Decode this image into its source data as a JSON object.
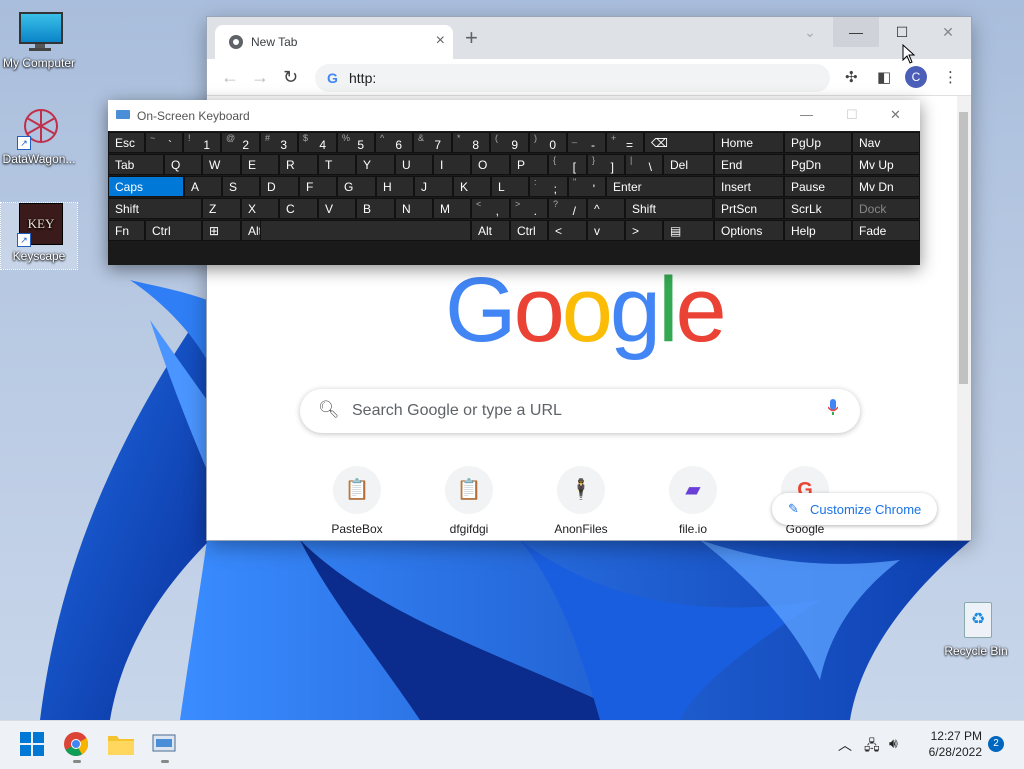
{
  "desktop": {
    "icons": [
      {
        "label": "My Computer",
        "icon": "monitor-icon"
      },
      {
        "label": "DataWagon...",
        "icon": "datawagon-icon"
      },
      {
        "label": "Keyscape",
        "icon": "keyscape-icon",
        "badge": "KEY"
      },
      {
        "label": "Recycle Bin",
        "icon": "recycle-bin-icon"
      }
    ]
  },
  "chrome": {
    "tab_title": "New Tab",
    "tab_close": "×",
    "new_tab": "+",
    "omnibox_text": "http:",
    "omnibox_g": "G",
    "avatar_letter": "C",
    "logo_letters": [
      {
        "ch": "G",
        "color": "#4285f4"
      },
      {
        "ch": "o",
        "color": "#ea4335"
      },
      {
        "ch": "o",
        "color": "#fbbc05"
      },
      {
        "ch": "g",
        "color": "#4285f4"
      },
      {
        "ch": "l",
        "color": "#34a853"
      },
      {
        "ch": "e",
        "color": "#ea4335"
      }
    ],
    "search_placeholder": "Search Google or type a URL",
    "shortcuts": [
      {
        "label": "PasteBox",
        "icon": "clipboard-icon",
        "glyph": "📋"
      },
      {
        "label": "dfgifdgi",
        "icon": "clipboard-icon",
        "glyph": "📋"
      },
      {
        "label": "AnonFiles",
        "icon": "anonfiles-icon",
        "glyph": "🕴"
      },
      {
        "label": "file.io",
        "icon": "fileio-icon",
        "glyph": "▰"
      },
      {
        "label": "Google",
        "icon": "google-icon",
        "glyph": "G"
      }
    ],
    "customize_label": "Customize Chrome"
  },
  "osk": {
    "title": "On-Screen Keyboard",
    "rows": [
      [
        {
          "m": "Esc"
        },
        {
          "s": "~",
          "b": "`"
        },
        {
          "s": "!",
          "b": "1"
        },
        {
          "s": "@",
          "b": "2"
        },
        {
          "s": "#",
          "b": "3"
        },
        {
          "s": "$",
          "b": "4"
        },
        {
          "s": "%",
          "b": "5"
        },
        {
          "s": "^",
          "b": "6"
        },
        {
          "s": "&",
          "b": "7"
        },
        {
          "s": "*",
          "b": "8"
        },
        {
          "s": "(",
          "b": "9"
        },
        {
          "s": ")",
          "b": "0"
        },
        {
          "s": "_",
          "b": "-"
        },
        {
          "s": "+",
          "b": "="
        },
        {
          "m": "⌫"
        },
        {
          "m": "Home"
        },
        {
          "m": "PgUp"
        },
        {
          "m": "Nav"
        }
      ],
      [
        {
          "m": "Tab"
        },
        {
          "m": "Q"
        },
        {
          "m": "W"
        },
        {
          "m": "E"
        },
        {
          "m": "R"
        },
        {
          "m": "T"
        },
        {
          "m": "Y"
        },
        {
          "m": "U"
        },
        {
          "m": "I"
        },
        {
          "m": "O"
        },
        {
          "m": "P"
        },
        {
          "s": "{",
          "b": "["
        },
        {
          "s": "}",
          "b": "]"
        },
        {
          "s": "|",
          "b": "\\"
        },
        {
          "m": "Del"
        },
        {
          "m": "End"
        },
        {
          "m": "PgDn"
        },
        {
          "m": "Mv Up"
        }
      ],
      [
        {
          "m": "Caps"
        },
        {
          "m": "A"
        },
        {
          "m": "S"
        },
        {
          "m": "D"
        },
        {
          "m": "F"
        },
        {
          "m": "G"
        },
        {
          "m": "H"
        },
        {
          "m": "J"
        },
        {
          "m": "K"
        },
        {
          "m": "L"
        },
        {
          "s": ":",
          "b": ";"
        },
        {
          "s": "\"",
          "b": "'"
        },
        {
          "m": "Enter"
        },
        {
          "m": "Insert"
        },
        {
          "m": "Pause"
        },
        {
          "m": "Mv Dn"
        }
      ],
      [
        {
          "m": "Shift"
        },
        {
          "m": "Z"
        },
        {
          "m": "X"
        },
        {
          "m": "C"
        },
        {
          "m": "V"
        },
        {
          "m": "B"
        },
        {
          "m": "N"
        },
        {
          "m": "M"
        },
        {
          "s": "<",
          "b": ","
        },
        {
          "s": ">",
          "b": "."
        },
        {
          "s": "?",
          "b": "/"
        },
        {
          "m": "^"
        },
        {
          "m": "Shift"
        },
        {
          "m": "PrtScn"
        },
        {
          "m": "ScrLk"
        },
        {
          "m": "Dock"
        }
      ],
      [
        {
          "m": "Fn"
        },
        {
          "m": "Ctrl"
        },
        {
          "m": "⊞"
        },
        {
          "m": "Alt"
        },
        {
          "m": ""
        },
        {
          "m": "Alt"
        },
        {
          "m": "Ctrl"
        },
        {
          "m": "<"
        },
        {
          "m": "v"
        },
        {
          "m": ">"
        },
        {
          "m": "▤"
        },
        {
          "m": "Options"
        },
        {
          "m": "Help"
        },
        {
          "m": "Fade"
        }
      ]
    ]
  },
  "taskbar": {
    "time": "12:27 PM",
    "date": "6/28/2022",
    "notifications": "2"
  }
}
